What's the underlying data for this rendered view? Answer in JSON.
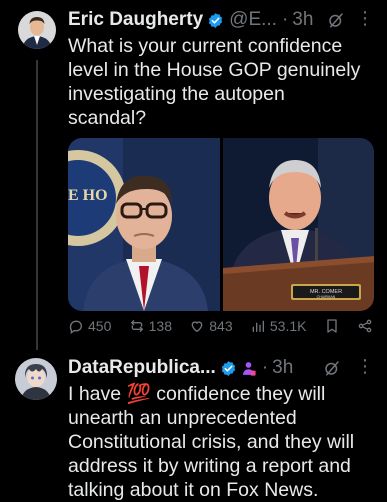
{
  "tweet1": {
    "author_name": "Eric Daugherty",
    "handle": "@E...",
    "separator": "·",
    "time": "3h",
    "text_lines": [
      "What is your current confidence",
      "level in the House GOP genuinely",
      "investigating the autopen",
      "scandal?"
    ],
    "nameplate": "MR. COMER",
    "nameplate_sub": "CHAIRMAN",
    "stats": {
      "replies": "450",
      "reposts": "138",
      "likes": "843",
      "views": "53.1K"
    }
  },
  "tweet2": {
    "author_name": "DataRepublica...",
    "separator": "·",
    "time": "3h",
    "emoji_100": "💯",
    "text_line1_before": "I have ",
    "text_line1_after": " confidence they will",
    "text_lines": [
      "unearth an unprecedented",
      "Constitutional crisis, and they will",
      "address it by writing a report and",
      "talking about it on Fox News."
    ]
  },
  "colors": {
    "background": "#000000",
    "text": "#e7e9ea",
    "muted": "#71767b",
    "verified": "#1d9bf0",
    "affiliate": "#a855f7"
  }
}
